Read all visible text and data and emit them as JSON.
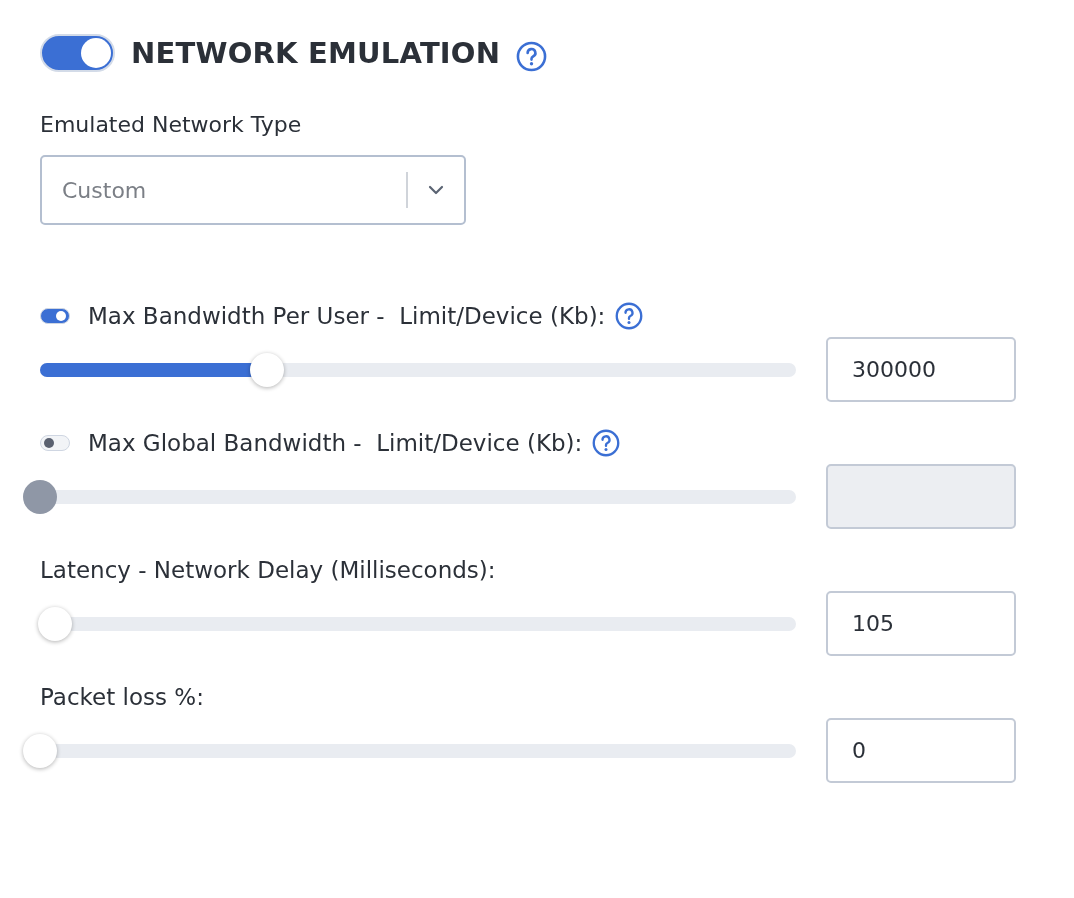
{
  "header": {
    "toggle_on": true,
    "title": "NETWORK EMULATION"
  },
  "network_type": {
    "label": "Emulated Network Type",
    "value": "Custom"
  },
  "sliders": [
    {
      "toggle": true,
      "toggle_on": true,
      "label": "Max Bandwidth Per User -  Limit/Device (Kb):",
      "help_icon": true,
      "disabled": false,
      "level": 0.3,
      "value": "300000"
    },
    {
      "toggle": true,
      "toggle_on": false,
      "label": "Max Global Bandwidth -  Limit/Device (Kb):",
      "help_icon": true,
      "disabled": true,
      "level": 0
    },
    {
      "toggle": false,
      "label": "Latency - Network Delay (Milliseconds):",
      "help_icon": false,
      "disabled": false,
      "level": 0.02,
      "value": "105"
    },
    {
      "toggle": false,
      "label": "Packet loss %:",
      "help_icon": false,
      "disabled": false,
      "level": 0,
      "value": "0"
    }
  ]
}
